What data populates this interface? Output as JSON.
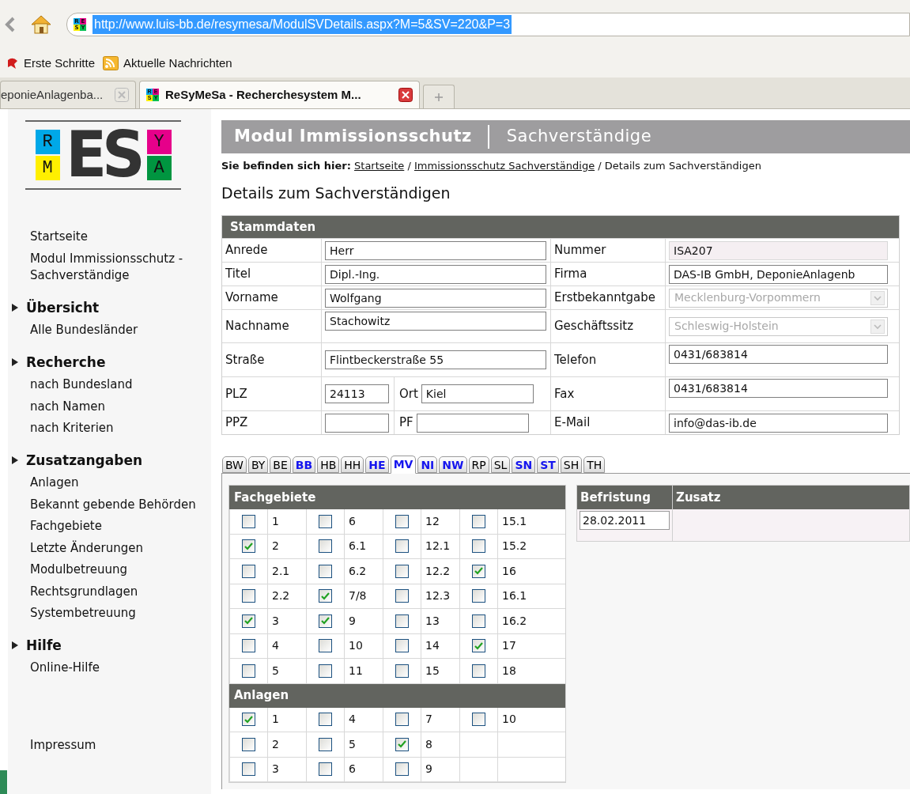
{
  "browser": {
    "url": "http://www.luis-bb.de/resymesa/ModulSVDetails.aspx?M=5&SV=220&P=3",
    "favicon_letters": [
      "R",
      "E",
      "S",
      "Y"
    ],
    "bookmarks": [
      {
        "label": "Erste Schritte",
        "kind": "page"
      },
      {
        "label": "Aktuelle Nachrichten",
        "kind": "feed"
      }
    ],
    "tabs": [
      {
        "title": "eponieAnlagenba...",
        "selected": false,
        "kind": "plain"
      },
      {
        "title": "ReSyMeSa - Recherchesystem M...",
        "selected": true,
        "kind": "site",
        "favicon_letters": [
          "R",
          "E",
          "S",
          "Y"
        ]
      }
    ]
  },
  "logo": {
    "letters": [
      "R",
      "E",
      "S",
      "Y",
      "M",
      "A"
    ]
  },
  "sidebar": [
    {
      "kind": "link",
      "text": "Startseite"
    },
    {
      "kind": "link",
      "text": "Modul Immissionsschutz - Sachverständige"
    },
    {
      "kind": "heading",
      "text": "Übersicht"
    },
    {
      "kind": "link",
      "text": "Alle Bundesländer"
    },
    {
      "kind": "heading",
      "text": "Recherche"
    },
    {
      "kind": "link",
      "text": "nach Bundesland"
    },
    {
      "kind": "link",
      "text": "nach Namen"
    },
    {
      "kind": "link",
      "text": "nach Kriterien"
    },
    {
      "kind": "heading",
      "text": "Zusatzangaben"
    },
    {
      "kind": "link",
      "text": "Anlagen"
    },
    {
      "kind": "link",
      "text": "Bekannt gebende Behörden"
    },
    {
      "kind": "link",
      "text": "Fachgebiete"
    },
    {
      "kind": "link",
      "text": "Letzte Änderungen"
    },
    {
      "kind": "link",
      "text": "Modulbetreuung"
    },
    {
      "kind": "link",
      "text": "Rechtsgrundlagen"
    },
    {
      "kind": "link",
      "text": "Systembetreuung"
    },
    {
      "kind": "heading",
      "text": "Hilfe"
    },
    {
      "kind": "link",
      "text": "Online-Hilfe"
    },
    {
      "kind": "spacer_link",
      "text": "Impressum"
    }
  ],
  "banner": {
    "module": "Modul Immissionsschutz",
    "section": "Sachverständige"
  },
  "breadcrumb": {
    "label": "Sie befinden sich hier:",
    "links": [
      "Startseite",
      "Immissionsschutz Sachverständige"
    ],
    "separators": [
      "/",
      "/"
    ],
    "current": "Details zum Sachverständigen"
  },
  "page_title": "Details zum Sachverständigen",
  "stammdaten": {
    "title": "Stammdaten",
    "rows": [
      {
        "left": [
          {
            "label": "Anrede",
            "value": "Herr",
            "kind": "text"
          }
        ],
        "right": {
          "label": "Nummer",
          "value": "ISA207",
          "kind": "readonly"
        }
      },
      {
        "left": [
          {
            "label": "Titel",
            "value": "Dipl.-Ing.",
            "kind": "text"
          }
        ],
        "right": {
          "label": "Firma",
          "value": "DAS-IB GmbH, DeponieAnlagenb",
          "kind": "text"
        }
      },
      {
        "left": [
          {
            "label": "Vorname",
            "value": "Wolfgang",
            "kind": "text"
          }
        ],
        "right": {
          "label": "Erstbekanntgabe",
          "value": "Mecklenburg-Vorpommern",
          "kind": "select",
          "disabled": true
        }
      },
      {
        "left": [
          {
            "label": "Nachname",
            "value": "Stachowitz",
            "kind": "text"
          }
        ],
        "right": {
          "label": "Geschäftssitz",
          "value": "Schleswig-Holstein",
          "kind": "select",
          "disabled": true
        }
      },
      {
        "left": [
          {
            "label": "Straße",
            "value": "Flintbeckerstraße 55",
            "kind": "text"
          }
        ],
        "right": {
          "label": "Telefon",
          "value": "0431/683814",
          "kind": "text"
        }
      },
      {
        "left": [
          {
            "label": "PLZ",
            "value": "24113",
            "kind": "text"
          },
          {
            "label": "Ort",
            "value": "Kiel",
            "kind": "text"
          }
        ],
        "right": {
          "label": "Fax",
          "value": "0431/683814",
          "kind": "text"
        }
      },
      {
        "left": [
          {
            "label": "PPZ",
            "kind": "text"
          },
          {
            "label": "PF",
            "kind": "text"
          }
        ],
        "right": {
          "label": "E-Mail",
          "value": "info@das-ib.de",
          "kind": "text"
        }
      }
    ]
  },
  "state_tabs": [
    {
      "label": "BW",
      "selected": false,
      "has_data": false
    },
    {
      "label": "BY",
      "selected": false,
      "has_data": false
    },
    {
      "label": "BE",
      "selected": false,
      "has_data": false
    },
    {
      "label": "BB",
      "selected": false,
      "has_data": true
    },
    {
      "label": "HB",
      "selected": false,
      "has_data": false
    },
    {
      "label": "HH",
      "selected": false,
      "has_data": false
    },
    {
      "label": "HE",
      "selected": false,
      "has_data": true
    },
    {
      "label": "MV",
      "selected": true,
      "has_data": true
    },
    {
      "label": "NI",
      "selected": false,
      "has_data": true
    },
    {
      "label": "NW",
      "selected": false,
      "has_data": true
    },
    {
      "label": "RP",
      "selected": false,
      "has_data": false
    },
    {
      "label": "SL",
      "selected": false,
      "has_data": false
    },
    {
      "label": "SN",
      "selected": false,
      "has_data": true
    },
    {
      "label": "ST",
      "selected": false,
      "has_data": true
    },
    {
      "label": "SH",
      "selected": false,
      "has_data": false
    },
    {
      "label": "TH",
      "selected": false,
      "has_data": false
    }
  ],
  "fachgebiete": {
    "title": "Fachgebiete",
    "rows": [
      [
        {
          "label": "1",
          "checked": false
        },
        {
          "label": "6",
          "checked": false
        },
        {
          "label": "12",
          "checked": false
        },
        {
          "label": "15.1",
          "checked": false
        }
      ],
      [
        {
          "label": "2",
          "checked": true
        },
        {
          "label": "6.1",
          "checked": false
        },
        {
          "label": "12.1",
          "checked": false
        },
        {
          "label": "15.2",
          "checked": false
        }
      ],
      [
        {
          "label": "2.1",
          "checked": false
        },
        {
          "label": "6.2",
          "checked": false
        },
        {
          "label": "12.2",
          "checked": false
        },
        {
          "label": "16",
          "checked": true
        }
      ],
      [
        {
          "label": "2.2",
          "checked": false
        },
        {
          "label": "7/8",
          "checked": true
        },
        {
          "label": "12.3",
          "checked": false
        },
        {
          "label": "16.1",
          "checked": false
        }
      ],
      [
        {
          "label": "3",
          "checked": true
        },
        {
          "label": "9",
          "checked": true
        },
        {
          "label": "13",
          "checked": false
        },
        {
          "label": "16.2",
          "checked": false
        }
      ],
      [
        {
          "label": "4",
          "checked": false
        },
        {
          "label": "10",
          "checked": false
        },
        {
          "label": "14",
          "checked": false
        },
        {
          "label": "17",
          "checked": true
        }
      ],
      [
        {
          "label": "5",
          "checked": false
        },
        {
          "label": "11",
          "checked": false
        },
        {
          "label": "15",
          "checked": false
        },
        {
          "label": "18",
          "checked": false
        }
      ]
    ]
  },
  "anlagen": {
    "title": "Anlagen",
    "rows": [
      [
        {
          "label": "1",
          "checked": true
        },
        {
          "label": "4",
          "checked": false
        },
        {
          "label": "7",
          "checked": false
        },
        {
          "label": "10",
          "checked": false
        }
      ],
      [
        {
          "label": "2",
          "checked": false
        },
        {
          "label": "5",
          "checked": false
        },
        {
          "label": "8",
          "checked": true
        }
      ],
      [
        {
          "label": "3",
          "checked": false
        },
        {
          "label": "6",
          "checked": false
        },
        {
          "label": "9",
          "checked": false
        }
      ]
    ]
  },
  "befristung": {
    "columns": [
      "Befristung",
      "Zusatz"
    ],
    "value": "28.02.2011"
  }
}
